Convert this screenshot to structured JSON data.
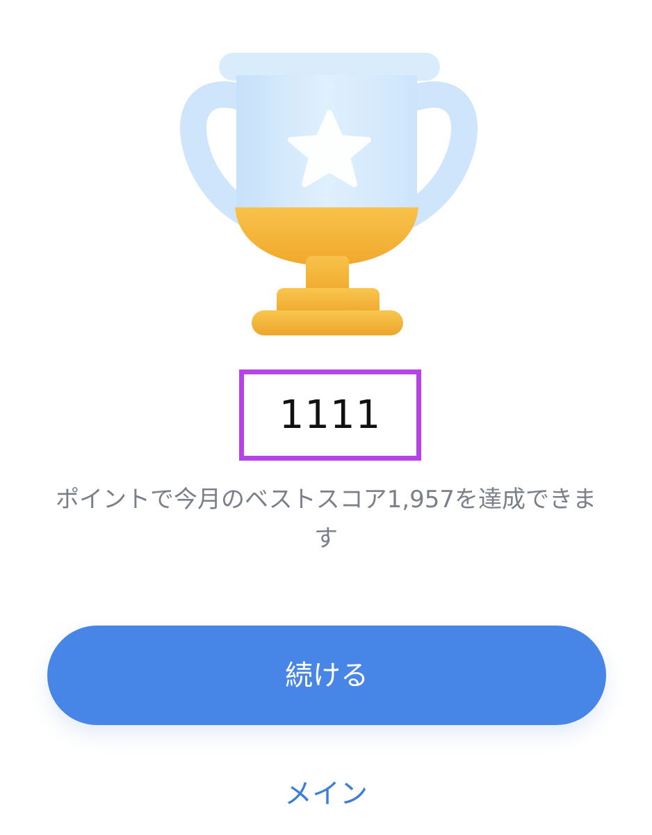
{
  "trophy": {
    "icon": "trophy-icon",
    "star_icon": "star-icon",
    "colors": {
      "cup": "#cfe6fb",
      "cup_light": "#e8f4fe",
      "gold": "#f6b73c",
      "gold_dark": "#eea52c"
    }
  },
  "score": {
    "value": "1111",
    "highlight_color": "#b543e8"
  },
  "message": {
    "text": "ポイントで今月のベストスコア1,957を達成できます"
  },
  "actions": {
    "continue_label": "続ける",
    "continue_color": "#4786e6",
    "main_label": "メイン",
    "main_color": "#3d7fd8"
  }
}
